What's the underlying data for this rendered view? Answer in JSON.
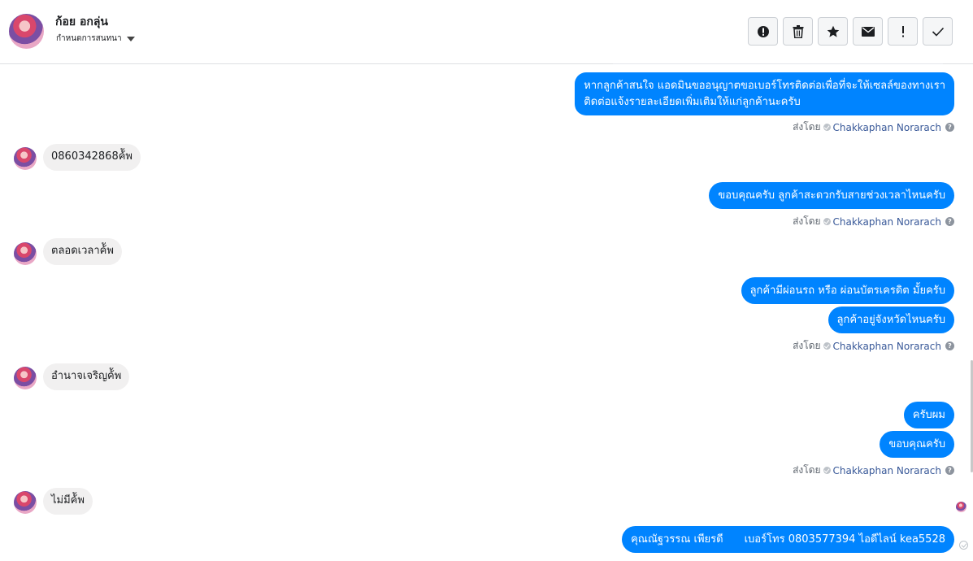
{
  "header": {
    "name": "ก้อย อกลุ่น",
    "assign_label": "กำหนดการสนทนา"
  },
  "toolbar": {
    "buttons": [
      {
        "icon": "alert-circle-icon",
        "label": "spam"
      },
      {
        "icon": "trash-icon",
        "label": "delete"
      },
      {
        "icon": "star-icon",
        "label": "star"
      },
      {
        "icon": "envelope-icon",
        "label": "mark unread"
      },
      {
        "icon": "exclamation-icon",
        "label": "follow up"
      },
      {
        "icon": "checkmark-icon",
        "label": "done"
      }
    ]
  },
  "sent_by": {
    "prefix": "ส่งโดย",
    "agent": "Chakkaphan Norarach",
    "help": "?"
  },
  "messages": {
    "out_1_line1": "หากลูกค้าสนใจ แอดมินขออนุญาตขอเบอร์โทรติดต่อเพื่อที่จะให้เซลล์ของทางเรา",
    "out_1_line2": "ติดต่อแจ้งรายละเอียดเพิ่มเติมให้แก่ลูกค้านะครับ",
    "in_1": "0860342868ค้ัพ",
    "out_2": "ขอบคุณครับ ลูกค้าสะดวกรับสายช่วงเวลาไหนครับ",
    "in_2": "ตลอดเวลาค้ัพ",
    "out_3": "ลูกค้ามีผ่อนรถ หรือ ผ่อนบัตรเครดิต มั้ยครับ",
    "out_4": "ลูกค้าอยู่จังหวัดไหนครับ",
    "in_3": "อำนาจเจริญค้ัพ",
    "out_5": "ครับผม",
    "out_6": "ขอบคุณครับ",
    "in_4": "ไม่มีค้ัพ",
    "out_7a": "คุณณัฐวรรณ เพียรดี",
    "out_7b": "เบอร์โทร 0803577394  ไอดีไลน์ kea5528"
  },
  "colors": {
    "outgoing_bubble": "#0084ff",
    "incoming_bubble": "#f1f0f0",
    "agent_link": "#385898"
  }
}
